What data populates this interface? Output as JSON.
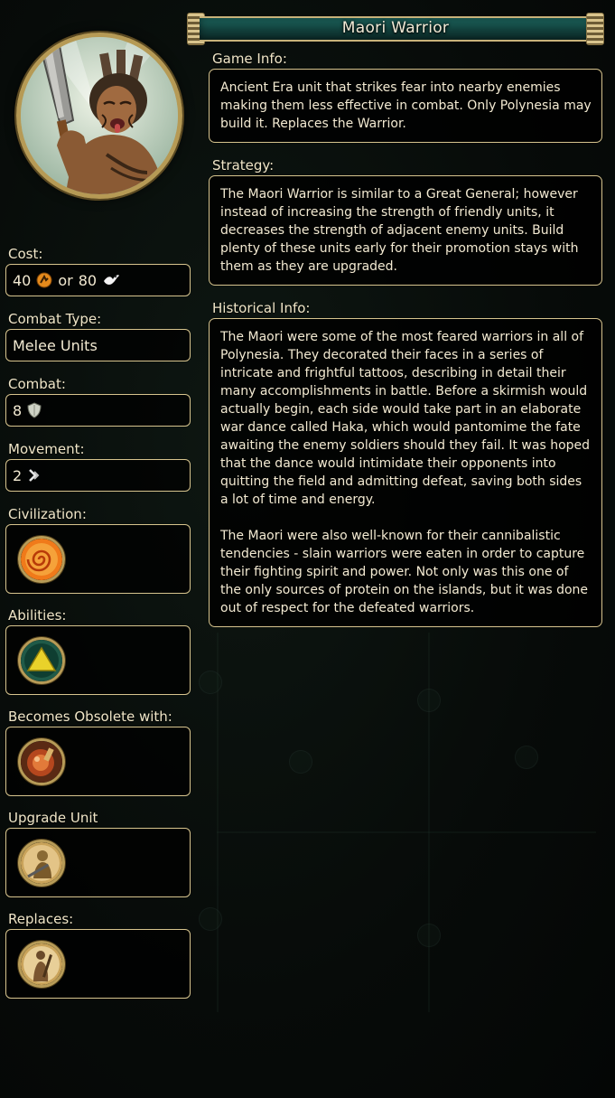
{
  "title": "Maori Warrior",
  "game_info": {
    "label": "Game Info:",
    "text": "Ancient Era unit that strikes fear into nearby enemies making them less effective in combat. Only Polynesia may build it. Replaces the Warrior."
  },
  "strategy": {
    "label": "Strategy:",
    "text": "The Maori Warrior is similar to a Great General; however instead of increasing the strength of friendly units, it decreases the strength of adjacent enemy units. Build plenty of these units early for their promotion stays with them as they are upgraded."
  },
  "historical_info": {
    "label": "Historical Info:",
    "text": "The Maori were some of the most feared warriors in all of Polynesia.  They decorated their faces in a series of intricate and frightful tattoos, describing in detail their many accomplishments in battle.  Before a skirmish would actually begin, each side would take part in an elaborate war dance called Haka, which would pantomime the fate awaiting the enemy soldiers should they fail.  It was hoped that the dance would intimidate their opponents into quitting the field and admitting defeat, saving both sides a lot of time and energy.\n\nThe Maori were also well-known for their cannibalistic tendencies - slain warriors were eaten in order to capture their fighting spirit and power.  Not only was this one of the only sources of protein on the islands, but it was done out of respect for the defeated warriors."
  },
  "stats": {
    "cost": {
      "label": "Cost:",
      "production": "40",
      "or": "or",
      "faith": "80"
    },
    "combat_type": {
      "label": "Combat Type:",
      "value": "Melee Units"
    },
    "combat": {
      "label": "Combat:",
      "value": "8"
    },
    "movement": {
      "label": "Movement:",
      "value": "2"
    }
  },
  "civilization": {
    "label": "Civilization:",
    "icon": "polynesia-emblem-icon"
  },
  "abilities": {
    "label": "Abilities:",
    "icon": "promotion-triangle-icon"
  },
  "obsolete": {
    "label": "Becomes Obsolete with:",
    "icon": "obsolete-tech-icon"
  },
  "upgrade": {
    "label": "Upgrade Unit",
    "icon": "swordsman-icon"
  },
  "replaces": {
    "label": "Replaces:",
    "icon": "warrior-icon"
  },
  "colors": {
    "border_gold": "#d7c48e",
    "banner_teal": "#1e6a62",
    "text": "#f3ead2"
  }
}
